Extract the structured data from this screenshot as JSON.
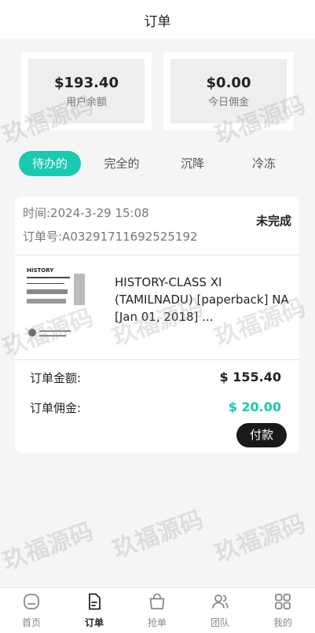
{
  "header": {
    "title": "订单"
  },
  "stats": [
    {
      "value": "$193.40",
      "label": "用户余额"
    },
    {
      "value": "$0.00",
      "label": "今日佣金"
    }
  ],
  "tabs": [
    "待办的",
    "完全的",
    "沉降",
    "冷冻"
  ],
  "order": {
    "time": "时间:2024-3-29 15:08",
    "number": "订单号:A03291711692525192",
    "status": "未完成",
    "product_title": "HISTORY-CLASS XI (TAMILNADU) [paperback] NA [Jan 01, 2018] ...",
    "thumb_text": "HISTORY",
    "amount_label": "订单金额:",
    "amount_value": "$ 155.40",
    "commission_label": "订单佣金:",
    "commission_value": "$ 20.00",
    "pay_button": "付款",
    "colors": {
      "commission": "#19c9b0",
      "accent": "#19c9b0"
    }
  },
  "watermark": "玖福源码",
  "nav": [
    {
      "label": "首页",
      "icon": "home-icon"
    },
    {
      "label": "订单",
      "icon": "order-icon"
    },
    {
      "label": "抢单",
      "icon": "grab-order-icon"
    },
    {
      "label": "团队",
      "icon": "team-icon"
    },
    {
      "label": "我的",
      "icon": "profile-icon"
    }
  ]
}
